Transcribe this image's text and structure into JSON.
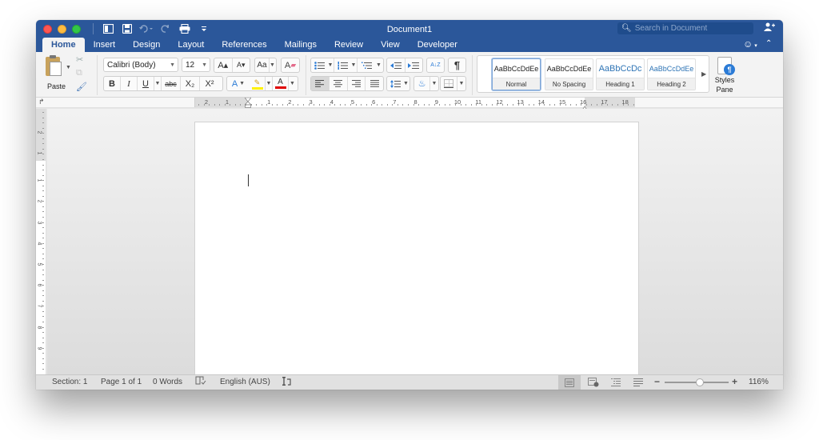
{
  "window": {
    "title": "Document1",
    "accent": "#2b579a"
  },
  "quick_access": {
    "items": [
      "sidebar-toggle",
      "save",
      "undo",
      "redo",
      "print",
      "customize"
    ]
  },
  "search": {
    "placeholder": "Search in Document",
    "value": ""
  },
  "tabs": [
    {
      "label": "Home",
      "active": true
    },
    {
      "label": "Insert",
      "active": false
    },
    {
      "label": "Design",
      "active": false
    },
    {
      "label": "Layout",
      "active": false
    },
    {
      "label": "References",
      "active": false
    },
    {
      "label": "Mailings",
      "active": false
    },
    {
      "label": "Review",
      "active": false
    },
    {
      "label": "View",
      "active": false
    },
    {
      "label": "Developer",
      "active": false
    }
  ],
  "ribbon": {
    "paste_label": "Paste",
    "font_name": "Calibri (Body)",
    "font_size": "12",
    "grow_font": "A▴",
    "shrink_font": "A▾",
    "change_case": "Aa",
    "bold": "B",
    "italic": "I",
    "underline": "U",
    "strikethrough": "abc",
    "subscript": "X₂",
    "superscript": "X²",
    "text_effects": "A",
    "highlight_color": "#fff200",
    "font_color_label": "A",
    "font_color": "#e00000",
    "sort_label": "A↓Z",
    "show_marks": "¶",
    "alignment_selected": "left",
    "styles": [
      {
        "sample": "AaBbCcDdEe",
        "name": "Normal",
        "selected": true
      },
      {
        "sample": "AaBbCcDdEe",
        "name": "No Spacing",
        "selected": false
      },
      {
        "sample": "AaBbCcDc",
        "name": "Heading 1",
        "selected": false
      },
      {
        "sample": "AaBbCcDdEe",
        "name": "Heading 2",
        "selected": false
      }
    ],
    "styles_pane_label_1": "Styles",
    "styles_pane_label_2": "Pane"
  },
  "ruler": {
    "horizontal_left_margin": [
      "2",
      "1"
    ],
    "horizontal_numbers": [
      "1",
      "2",
      "3",
      "4",
      "5",
      "6",
      "7",
      "8",
      "9",
      "10",
      "11",
      "12",
      "13",
      "14",
      "15",
      "16",
      "17",
      "18"
    ],
    "vertical_top_margin": [
      "2",
      "1"
    ],
    "vertical_numbers": [
      "1",
      "2",
      "3",
      "4",
      "5",
      "6",
      "7",
      "8",
      "9"
    ]
  },
  "document": {
    "content": ""
  },
  "status": {
    "section": "Section: 1",
    "page": "Page 1 of 1",
    "words": "0 Words",
    "language": "English (AUS)",
    "zoom_minus": "−",
    "zoom_plus": "+",
    "zoom_percent": "116%",
    "zoom_fraction": 0.55
  }
}
